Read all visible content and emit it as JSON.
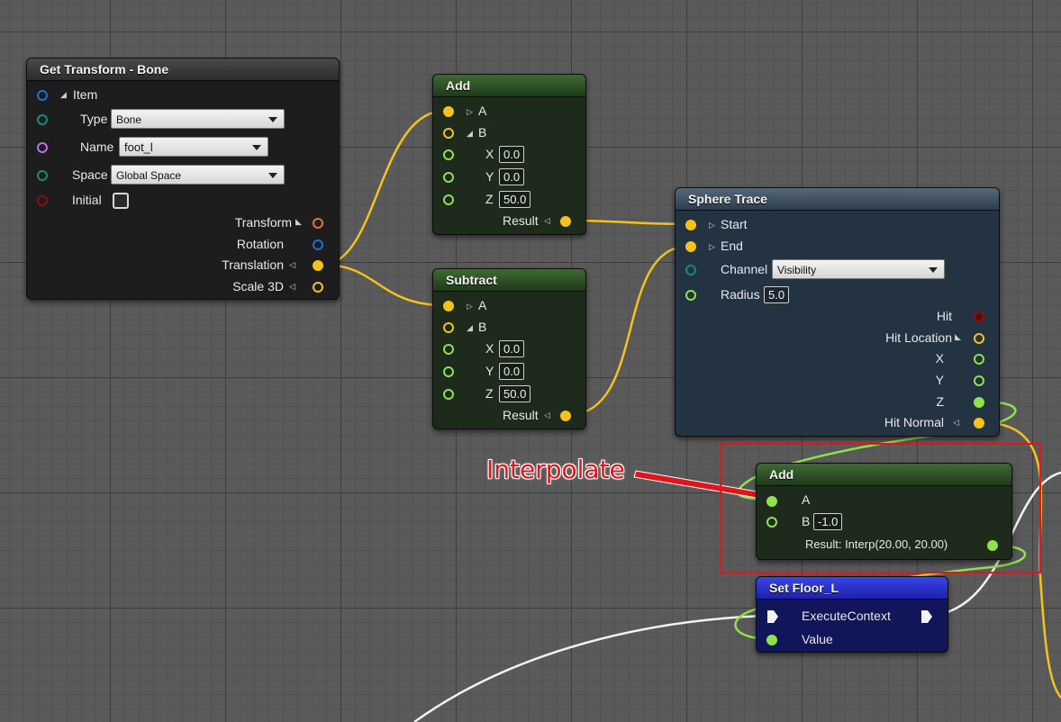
{
  "colors": {
    "vector_pin": "#f4c21a",
    "float_pin": "#8ee24a",
    "struct_pin": "#1a6fd8",
    "byte_pin": "#0c8f7e",
    "name_pin": "#c46ee8",
    "bool_pin": "#8a1010",
    "transform_pin": "#e0762a",
    "annotation": "#e0161c"
  },
  "get_transform": {
    "title": "Get Transform - Bone",
    "item_label": "Item",
    "type_label": "Type",
    "type_value": "Bone",
    "name_label": "Name",
    "name_value": "foot_l",
    "space_label": "Space",
    "space_value": "Global Space",
    "initial_label": "Initial",
    "out_transform": "Transform",
    "out_rotation": "Rotation",
    "out_translation": "Translation",
    "out_scale": "Scale 3D"
  },
  "add_node": {
    "title": "Add",
    "a_label": "A",
    "b_label": "B",
    "x_label": "X",
    "x_value": "0.0",
    "y_label": "Y",
    "y_value": "0.0",
    "z_label": "Z",
    "z_value": "50.0",
    "result_label": "Result"
  },
  "subtract_node": {
    "title": "Subtract",
    "a_label": "A",
    "b_label": "B",
    "x_label": "X",
    "x_value": "0.0",
    "y_label": "Y",
    "y_value": "0.0",
    "z_label": "Z",
    "z_value": "50.0",
    "result_label": "Result"
  },
  "sphere_trace": {
    "title": "Sphere Trace",
    "start_label": "Start",
    "end_label": "End",
    "channel_label": "Channel",
    "channel_value": "Visibility",
    "radius_label": "Radius",
    "radius_value": "5.0",
    "hit_label": "Hit",
    "hit_location_label": "Hit Location",
    "x_label": "X",
    "y_label": "Y",
    "z_label": "Z",
    "hit_normal_label": "Hit Normal"
  },
  "add_float": {
    "title": "Add",
    "a_label": "A",
    "b_label": "B",
    "b_value": "-1.0",
    "result_text": "Result:  Interp(20.00, 20.00)"
  },
  "set_floor": {
    "title": "Set Floor_L",
    "execute_label": "ExecuteContext",
    "value_label": "Value"
  },
  "annotation": {
    "text": "Interpolate"
  }
}
